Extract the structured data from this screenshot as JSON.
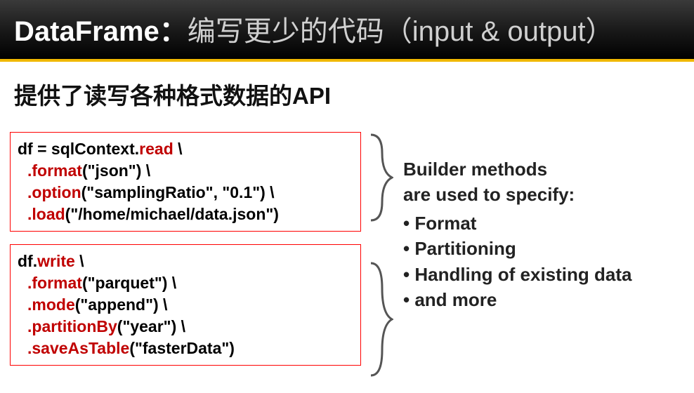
{
  "header": {
    "title_bold": "DataFrame：",
    "title_rest": "编写更少的代码（input & output）"
  },
  "subtitle": "提供了读写各种格式数据的API",
  "code1": {
    "line1_pre": "df = sqlContext.",
    "line1_m": "read",
    "line1_post": " \\",
    "line2_m": "format",
    "line2_args": "(\"json\") \\",
    "line3_m": "option",
    "line3_args": "(\"samplingRatio\", \"0.1\")  \\",
    "line4_m": "load",
    "line4_args": "(\"/home/michael/data.json\")"
  },
  "code2": {
    "line1_pre": "df.",
    "line1_m": "write",
    "line1_post": "  \\",
    "line2_m": "format",
    "line2_args": "(\"parquet\") \\",
    "line3_m": "mode",
    "line3_args": "(\"append\") \\",
    "line4_m": "partitionBy",
    "line4_args": "(\"year\") \\",
    "line5_m": "saveAsTable",
    "line5_args": "(\"fasterData\")"
  },
  "info": {
    "lead1": "Builder methods",
    "lead2": "are used to specify:",
    "bullets": [
      "Format",
      "Partitioning",
      "Handling of existing data",
      "and more"
    ]
  }
}
